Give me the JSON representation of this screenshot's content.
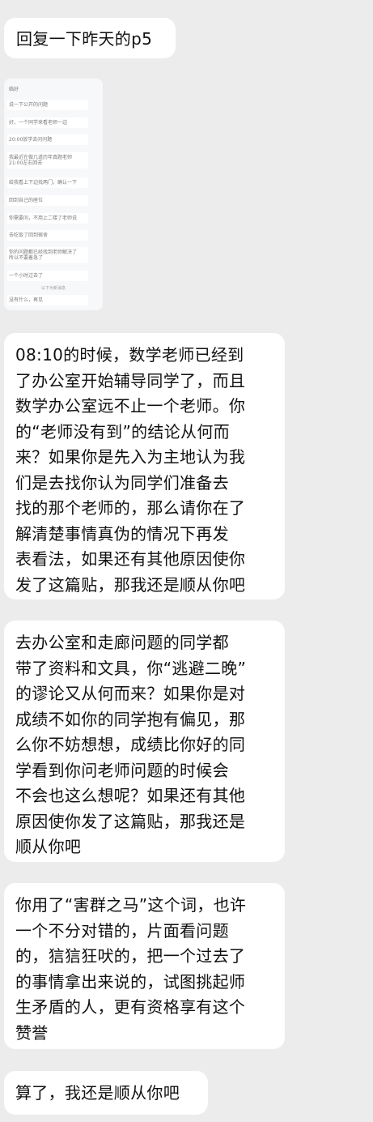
{
  "messages": [
    {
      "text": "回复一下昨天的p5"
    },
    {
      "screenshot": {
        "items": [
          "临好",
          "说一下公开的问题",
          "好，一个同学来看老师一边",
          "20:00放学去问问题",
          "我最近在做几道历年真题老师\n21:00左右回去",
          "给我看上下边找两门，确认一下",
          "回到自己的座位",
          "你需要问，不用上二楼了老师说",
          "去吃饭了回到宿舍",
          "你的问题都已经找到老师解决了\n所以不要着急了",
          "一个小时过去了",
          "没有什么，再见"
        ],
        "footer": "以下为新消息"
      }
    },
    {
      "text": "08:10的时候，数学老师已经到\n了办公室开始辅导同学了，而且\n数学办公室远不止一个老师。你\n的“老师没有到”的结论从何而\n来？如果你是先入为主地认为我\n们是去找你认为同学们准备去\n找的那个老师的，那么请你在了\n解清楚事情真伪的情况下再发\n表看法，如果还有其他原因使你\n发了这篇贴，那我还是顺从你吧"
    },
    {
      "text": "去办公室和走廊问题的同学都\n带了资料和文具，你“逃避二晚”\n的谬论又从何而来？如果你是对\n成绩不如你的同学抱有偏见，那\n么你不妨想想，成绩比你好的同\n学看到你问老师问题的时候会\n不会也这么想呢？如果还有其他\n原因使你发了这篇贴，那我还是\n顺从你吧"
    },
    {
      "text": "你用了“害群之马”这个词，也许\n一个不分对错的，片面看问题\n的，狺狺狂吠的，把一个过去了\n的事情拿出来说的，试图挑起师\n生矛盾的人，更有资格享有这个\n赞誉"
    },
    {
      "text": "算了，我还是顺从你吧"
    }
  ]
}
